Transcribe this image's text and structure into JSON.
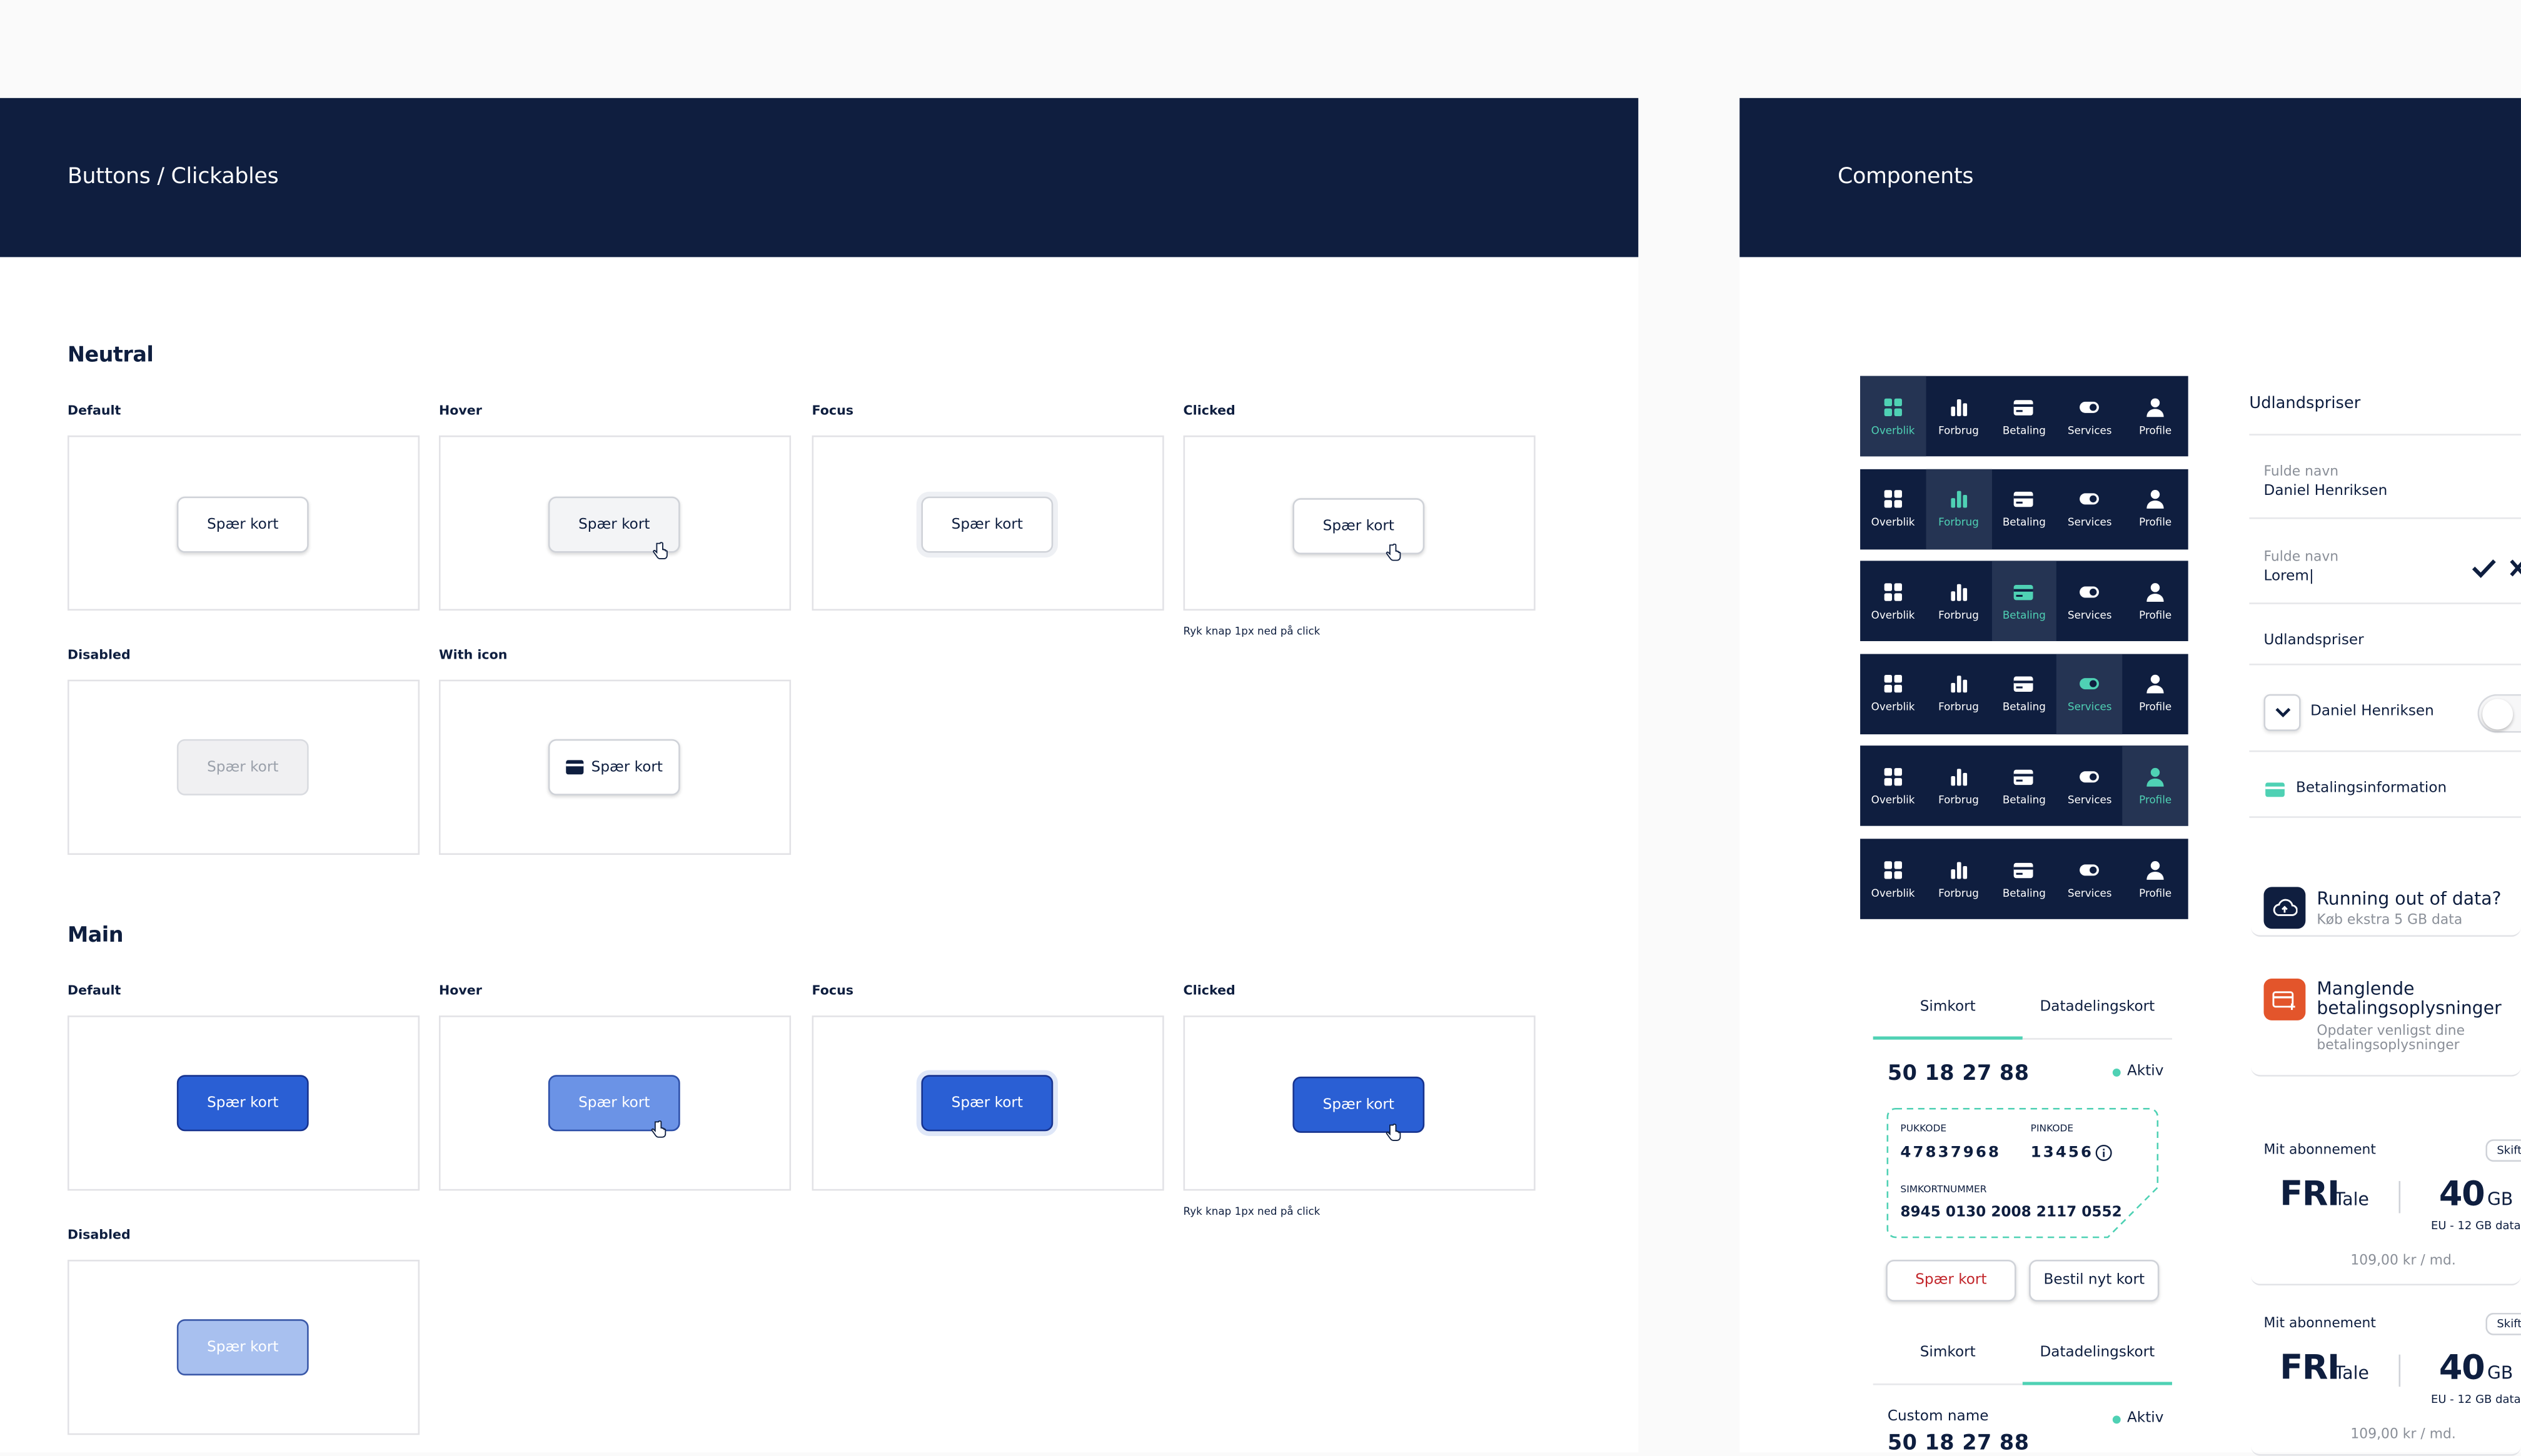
{
  "left_panel": {
    "title": "Buttons / Clickables",
    "neutral": {
      "heading": "Neutral",
      "states": {
        "default": "Default",
        "hover": "Hover",
        "focus": "Focus",
        "clicked": "Clicked",
        "disabled": "Disabled",
        "with_icon": "With icon"
      },
      "button_label": "Spær kort",
      "clicked_note": "Ryk knap 1px ned på click"
    },
    "main": {
      "heading": "Main",
      "states": {
        "default": "Default",
        "hover": "Hover",
        "focus": "Focus",
        "clicked": "Clicked",
        "disabled": "Disabled"
      },
      "button_label": "Spær kort",
      "clicked_note": "Ryk knap 1px ned på click"
    },
    "icons": {
      "card": "credit-card-icon",
      "cursor": "hand-pointer-icon"
    },
    "colors": {
      "header": "#0f1e3f",
      "primary": "#2a5fd4",
      "accent": "#4fd1b4"
    }
  },
  "right_panel": {
    "title": "Components",
    "nav": {
      "items": [
        "Overblik",
        "Forbrug",
        "Betaling",
        "Services",
        "Profile"
      ],
      "active_per_row": [
        0,
        1,
        2,
        3,
        4,
        -1
      ]
    },
    "sim_card_1": {
      "tabs": [
        "Simkort",
        "Datadelingskort"
      ],
      "active_tab": 0,
      "number": "50 18 27 88",
      "status": "Aktiv",
      "puk_label": "PUKKODE",
      "puk": "47837968",
      "pin_label": "PINKODE",
      "pin": "13456",
      "sim_label": "SIMKORTNUMMER",
      "sim_number": "8945 0130 2008 2117 0552",
      "block_button": "Spær kort",
      "order_button": "Bestil nyt kort"
    },
    "sim_card_2": {
      "tabs": [
        "Simkort",
        "Datadelingskort"
      ],
      "active_tab": 1,
      "custom_name": "Custom name",
      "status": "Aktiv",
      "number": "50 18 27 88"
    },
    "form": {
      "heading": "Udlandspriser",
      "field1_label": "Fulde navn",
      "field1_value": "Daniel Henriksen",
      "field2_label": "Fulde navn",
      "field2_value": "Lorem|",
      "section2": "Udlandspriser",
      "dropdown_value": "Daniel Henriksen",
      "payment_info": "Betalingsinformation"
    },
    "alerts": [
      {
        "title": "Running out of data?",
        "subtitle": "Køb ekstra 5 GB data",
        "icon": "cloud-upload-icon"
      },
      {
        "title": "Manglende betalingsoplysninger",
        "subtitle": "Opdater venligst dine betalingsoplysninger",
        "icon": "card-warning-icon"
      }
    ],
    "subscriptions": [
      {
        "label": "Mit abonnement",
        "tag": "Skift",
        "talk": "FRI",
        "talk_unit": "Tale",
        "data": "40",
        "data_unit": "GB",
        "eu": "EU - 12 GB data",
        "price": "109,00 kr / md."
      },
      {
        "label": "Mit abonnement",
        "tag": "Skift",
        "talk": "FRI",
        "talk_unit": "Tale",
        "data": "40",
        "data_unit": "GB",
        "eu": "EU - 12 GB data",
        "price": "109,00 kr / md."
      }
    ]
  }
}
